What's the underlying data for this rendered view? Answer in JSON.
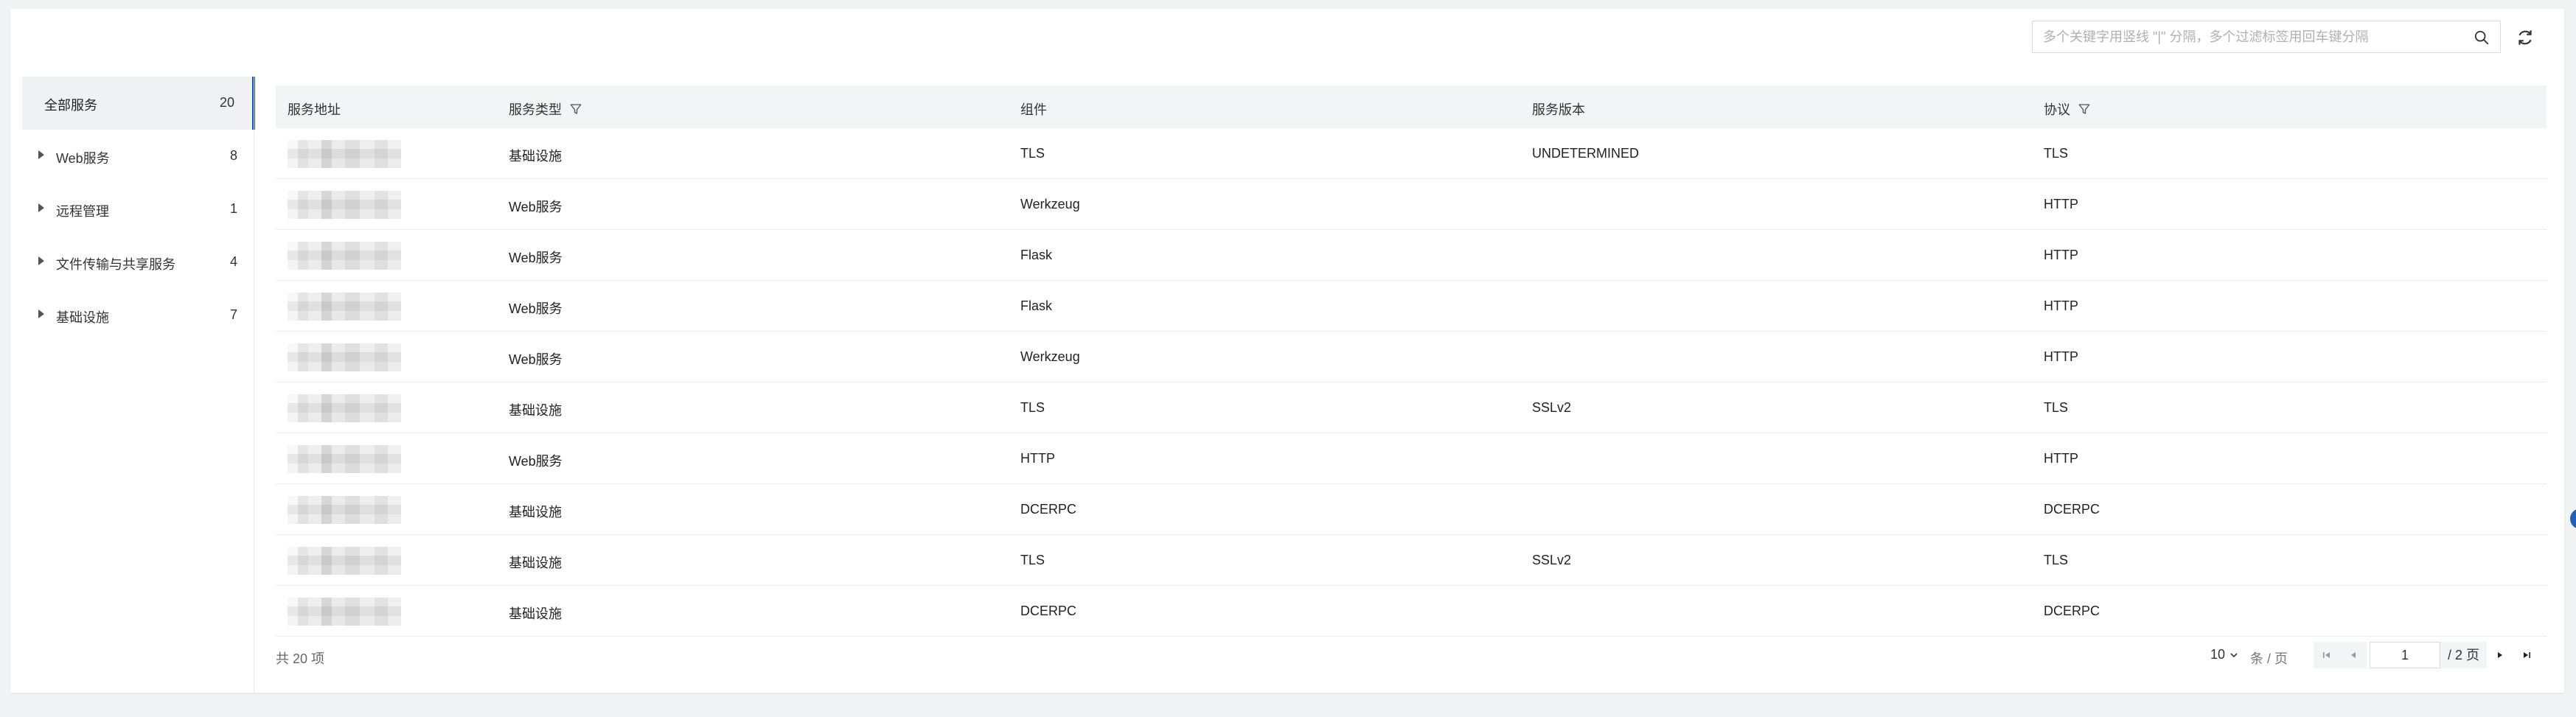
{
  "search": {
    "placeholder": "多个关键字用竖线 \"|\" 分隔，多个过滤标签用回车键分隔",
    "value": ""
  },
  "sidebar": {
    "items": [
      {
        "label": "全部服务",
        "count": "20",
        "active": true,
        "expandable": false
      },
      {
        "label": "Web服务",
        "count": "8",
        "active": false,
        "expandable": true
      },
      {
        "label": "远程管理",
        "count": "1",
        "active": false,
        "expandable": true
      },
      {
        "label": "文件传输与共享服务",
        "count": "4",
        "active": false,
        "expandable": true
      },
      {
        "label": "基础设施",
        "count": "7",
        "active": false,
        "expandable": true
      }
    ]
  },
  "table": {
    "columns": [
      {
        "label": "服务地址",
        "filterable": false
      },
      {
        "label": "服务类型",
        "filterable": true
      },
      {
        "label": "组件",
        "filterable": false
      },
      {
        "label": "服务版本",
        "filterable": false
      },
      {
        "label": "协议",
        "filterable": true
      }
    ],
    "rows": [
      {
        "address": "",
        "type": "基础设施",
        "component": "TLS",
        "version": "UNDETERMINED",
        "protocol": "TLS"
      },
      {
        "address": "",
        "type": "Web服务",
        "component": "Werkzeug",
        "version": "",
        "protocol": "HTTP"
      },
      {
        "address": "",
        "type": "Web服务",
        "component": "Flask",
        "version": "",
        "protocol": "HTTP"
      },
      {
        "address": "",
        "type": "Web服务",
        "component": "Flask",
        "version": "",
        "protocol": "HTTP"
      },
      {
        "address": "",
        "type": "Web服务",
        "component": "Werkzeug",
        "version": "",
        "protocol": "HTTP"
      },
      {
        "address": "",
        "type": "基础设施",
        "component": "TLS",
        "version": "SSLv2",
        "protocol": "TLS"
      },
      {
        "address": "",
        "type": "Web服务",
        "component": "HTTP",
        "version": "",
        "protocol": "HTTP"
      },
      {
        "address": "",
        "type": "基础设施",
        "component": "DCERPC",
        "version": "",
        "protocol": "DCERPC"
      },
      {
        "address": "",
        "type": "基础设施",
        "component": "TLS",
        "version": "SSLv2",
        "protocol": "TLS"
      },
      {
        "address": "",
        "type": "基础设施",
        "component": "DCERPC",
        "version": "",
        "protocol": "DCERPC"
      }
    ]
  },
  "footer": {
    "total": "共 20 项",
    "page_size": "10",
    "per_page_label": "条 / 页",
    "current_page": "1",
    "total_pages_label": "/ 2 页"
  },
  "colors": {
    "accent": "#0052d9",
    "header_bg": "#f3f4f6",
    "sidebar_active_bg": "#f0f1f3"
  }
}
